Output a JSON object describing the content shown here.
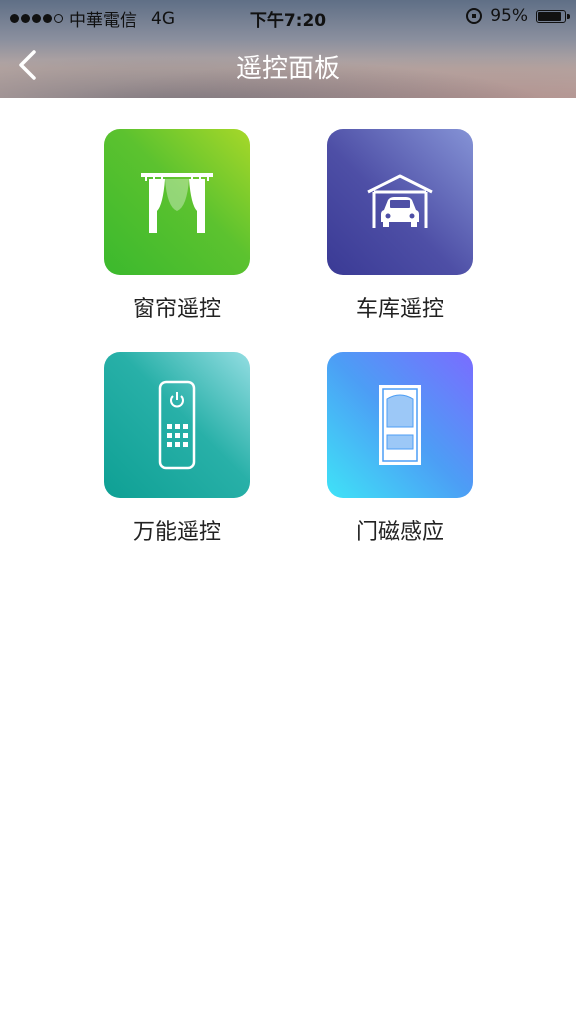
{
  "status_bar": {
    "carrier": "中華電信",
    "network": "4G",
    "time": "下午7:20",
    "battery": "95%"
  },
  "nav": {
    "title": "遥控面板",
    "back_icon": "chevron-left-icon"
  },
  "tiles": [
    {
      "label": "窗帘遥控",
      "icon": "curtain-icon",
      "colors": [
        "#a7d829",
        "#3bb92d"
      ]
    },
    {
      "label": "车库遥控",
      "icon": "garage-icon",
      "colors": [
        "#8593d6",
        "#3a3a95"
      ]
    },
    {
      "label": "万能遥控",
      "icon": "remote-control-icon",
      "colors": [
        "#93dde2",
        "#0ea094"
      ]
    },
    {
      "label": "门磁感应",
      "icon": "door-icon",
      "colors": [
        "#7a6cff",
        "#3fe3f7"
      ]
    }
  ]
}
